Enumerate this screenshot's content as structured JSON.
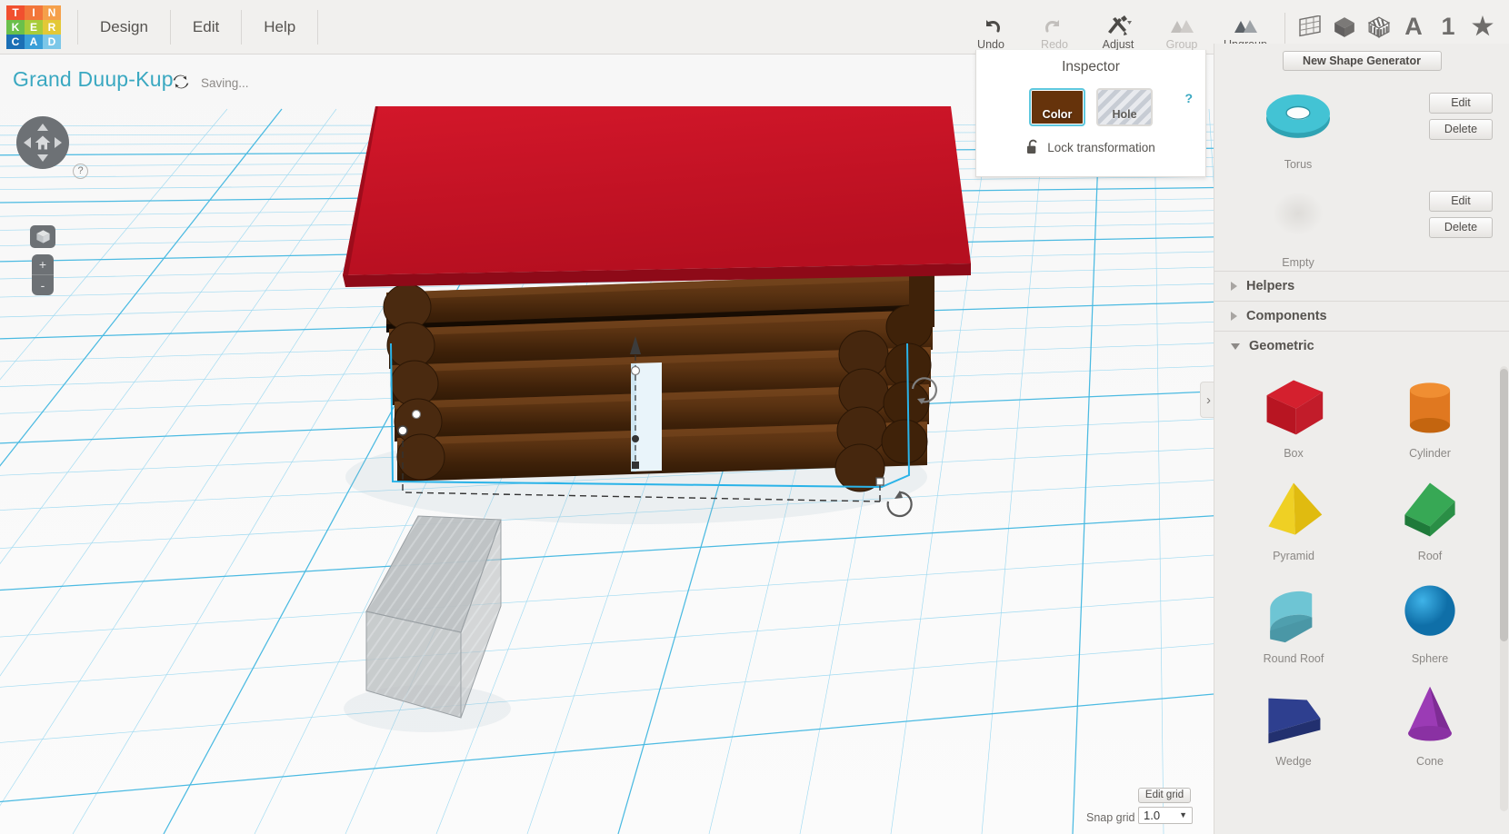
{
  "app": {
    "logo_letters": [
      "T",
      "I",
      "N",
      "K",
      "E",
      "R",
      "C",
      "A",
      "D"
    ],
    "logo_colors": [
      "#f1502f",
      "#f2763a",
      "#f5a04a",
      "#6ac04b",
      "#a8cc3a",
      "#e3c836",
      "#1b6fb5",
      "#3a9fd8",
      "#7cc7e8"
    ]
  },
  "menubar": {
    "items": [
      {
        "label": "Design"
      },
      {
        "label": "Edit"
      },
      {
        "label": "Help"
      }
    ]
  },
  "toolbar": {
    "tools": [
      {
        "label": "Undo",
        "icon": "undo-arrow-icon",
        "enabled": true
      },
      {
        "label": "Redo",
        "icon": "redo-arrow-icon",
        "enabled": false
      },
      {
        "label": "Adjust",
        "icon": "adjust-tools-icon",
        "enabled": true
      },
      {
        "label": "Group",
        "icon": "group-mountains-icon",
        "enabled": false
      },
      {
        "label": "Ungroup",
        "icon": "ungroup-mountains-icon",
        "enabled": true
      }
    ],
    "right_icons": [
      {
        "name": "workplane-grid-icon",
        "glyph": ""
      },
      {
        "name": "solid-cube-icon",
        "glyph": ""
      },
      {
        "name": "striped-cube-icon",
        "glyph": ""
      },
      {
        "name": "text-a-icon",
        "glyph": "A"
      },
      {
        "name": "number-one-icon",
        "glyph": "1"
      },
      {
        "name": "star-favorite-icon",
        "glyph": "★"
      }
    ]
  },
  "project": {
    "title": "Grand Duup-Kup",
    "sync_icon": "sync-refresh-icon",
    "status": "Saving..."
  },
  "nav_widget": {
    "home_icon": "home-view-icon",
    "help_label": "?",
    "cube_icon": "fit-view-cube-icon",
    "zoom_in": "+",
    "zoom_out": "-"
  },
  "inspector": {
    "title": "Inspector",
    "help_label": "?",
    "color_swatch": {
      "label": "Color",
      "hex": "#66330b"
    },
    "hole_swatch": {
      "label": "Hole"
    },
    "lock": {
      "icon": "unlocked-padlock-icon",
      "label": "Lock transformation"
    }
  },
  "right_panel": {
    "new_shape_generator": "New Shape Generator",
    "generators": [
      {
        "name": "Torus",
        "edit": "Edit",
        "delete": "Delete",
        "thumb": "torus"
      },
      {
        "name": "Empty",
        "edit": "Edit",
        "delete": "Delete",
        "thumb": "empty"
      }
    ],
    "sections": [
      {
        "title": "Helpers",
        "expanded": false
      },
      {
        "title": "Components",
        "expanded": false
      },
      {
        "title": "Geometric",
        "expanded": true
      }
    ],
    "shapes": [
      {
        "name": "Box",
        "color": "#c7202c",
        "art": "box"
      },
      {
        "name": "Cylinder",
        "color": "#e07820",
        "art": "cylinder"
      },
      {
        "name": "Pyramid",
        "color": "#e8c820",
        "art": "pyramid"
      },
      {
        "name": "Roof",
        "color": "#2a9044",
        "art": "roof"
      },
      {
        "name": "Round Roof",
        "color": "#56b8c6",
        "art": "roundroof"
      },
      {
        "name": "Sphere",
        "color": "#1c8ec4",
        "art": "sphere"
      },
      {
        "name": "Wedge",
        "color": "#2e3f8f",
        "art": "wedge"
      },
      {
        "name": "Cone",
        "color": "#9b3bb5",
        "art": "cone"
      }
    ],
    "collapse_toggle": "›"
  },
  "grid_controls": {
    "edit_grid_label": "Edit grid",
    "snap_grid_label": "Snap grid",
    "snap_grid_value": "1.0",
    "snap_caret": "▼"
  },
  "scene": {
    "roof_color": "#cc1325",
    "log_color": "#4e2d12",
    "selection_color": "#2ab3e8",
    "block_color": "#b9bcbe"
  }
}
